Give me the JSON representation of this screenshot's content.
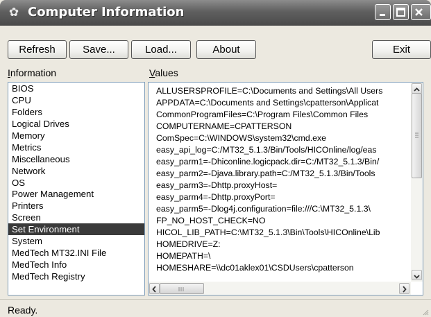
{
  "window": {
    "title": "Computer Information"
  },
  "toolbar": {
    "refresh_label": "Refresh",
    "save_label": "Save...",
    "load_label": "Load...",
    "about_label": "About",
    "exit_label": "Exit"
  },
  "panes": {
    "information_label": "nformation",
    "information_mnemonic": "I",
    "values_label": "alues",
    "values_mnemonic": "V"
  },
  "information_list": {
    "selected": "Set Environment",
    "items": [
      "BIOS",
      "CPU",
      "Folders",
      "Logical Drives",
      "Memory",
      "Metrics",
      "Miscellaneous",
      "Network",
      "OS",
      "Power Management",
      "Printers",
      "Screen",
      "Set Environment",
      "System",
      "MedTech MT32.INI File",
      "MedTech Info",
      "MedTech Registry"
    ]
  },
  "values_list": {
    "lines": [
      "ALLUSERSPROFILE=C:\\Documents and Settings\\All Users",
      "APPDATA=C:\\Documents and Settings\\cpatterson\\Applicat",
      "CommonProgramFiles=C:\\Program Files\\Common Files",
      "COMPUTERNAME=CPATTERSON",
      "ComSpec=C:\\WINDOWS\\system32\\cmd.exe",
      "easy_api_log=C:/MT32_5.1.3/Bin/Tools/HICOnline/log/eas",
      "easy_parm1=-Dhiconline.logicpack.dir=C:/MT32_5.1.3/Bin/",
      "easy_parm2=-Djava.library.path=C:/MT32_5.1.3/Bin/Tools",
      "easy_parm3=-Dhttp.proxyHost=",
      "easy_parm4=-Dhttp.proxyPort=",
      "easy_parm5=-Dlog4j.configuration=file:///C:\\MT32_5.1.3\\",
      "FP_NO_HOST_CHECK=NO",
      "HICOL_LIB_PATH=C:\\MT32_5.1.3\\Bin\\Tools\\HICOnline\\Lib",
      "HOMEDRIVE=Z:",
      "HOMEPATH=\\",
      "HOMESHARE=\\\\dc01aklex01\\CSDUsers\\cpatterson"
    ]
  },
  "status": {
    "text": "Ready."
  }
}
